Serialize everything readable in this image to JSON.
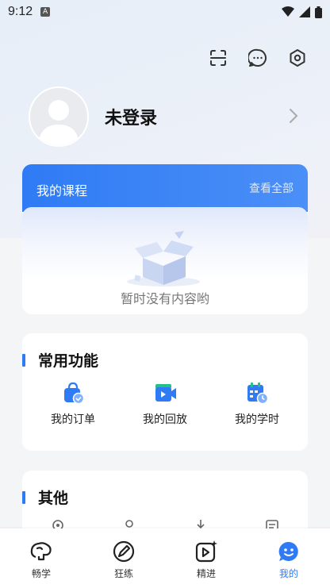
{
  "status_bar": {
    "time": "9:12",
    "badge": "A"
  },
  "top_actions": [
    {
      "icon": "scan-icon"
    },
    {
      "icon": "message-icon"
    },
    {
      "icon": "settings-icon"
    }
  ],
  "profile": {
    "name": "未登录"
  },
  "course": {
    "title": "我的课程",
    "view_all": "查看全部",
    "empty_text": "暂时没有内容哟"
  },
  "common_functions": {
    "title": "常用功能",
    "items": [
      {
        "label": "我的订单",
        "icon": "order-bag-icon"
      },
      {
        "label": "我的回放",
        "icon": "replay-video-icon"
      },
      {
        "label": "我的学时",
        "icon": "study-hours-calendar-icon"
      }
    ]
  },
  "other": {
    "title": "其他"
  },
  "bottom_nav": {
    "items": [
      {
        "label": "畅学",
        "icon": "brain-icon"
      },
      {
        "label": "狂练",
        "icon": "pencil-icon"
      },
      {
        "label": "精进",
        "icon": "play-star-icon"
      },
      {
        "label": "我的",
        "icon": "smile-face-icon"
      }
    ],
    "active_index": 3
  },
  "colors": {
    "accent": "#2f7bf5",
    "green": "#22c08a"
  }
}
